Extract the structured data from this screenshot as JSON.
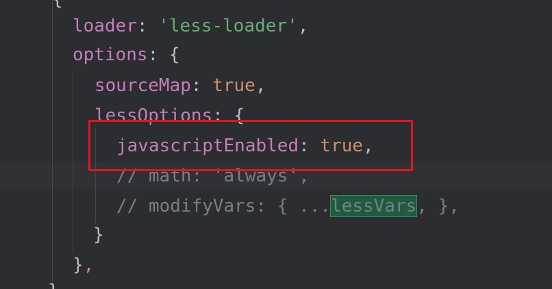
{
  "code": {
    "top_fragment": "{",
    "line1": {
      "key": "loader",
      "colon": ": ",
      "value": "'less-loader'",
      "trail": ","
    },
    "line2": {
      "key": "options",
      "colon": ": ",
      "brace": "{"
    },
    "line3": {
      "key": "sourceMap",
      "colon": ": ",
      "value": "true",
      "trail": ","
    },
    "line4": {
      "key": "lessOptions",
      "colon": ": ",
      "brace": "{"
    },
    "line5": {
      "key": "javascriptEnabled",
      "colon": ": ",
      "value": "true",
      "trail": ","
    },
    "line6": {
      "comment": "// math: 'always',"
    },
    "line7": {
      "comment_prefix": "// modifyVars: { ...",
      "highlight": "lessVars",
      "comment_suffix": ", },"
    },
    "line8": {
      "brace": "}"
    },
    "line9": {
      "brace": "}",
      "trail": ","
    },
    "bottom_fragment": "}"
  },
  "annotation": {
    "highlight_color": "#e8141c"
  }
}
